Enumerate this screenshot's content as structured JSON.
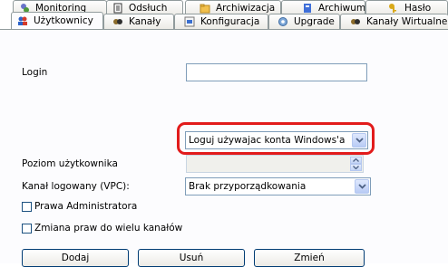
{
  "tabs_row1": [
    {
      "label": "Monitoring",
      "icon": "monitoring-icon"
    },
    {
      "label": "Odsłuch",
      "icon": "document-icon"
    },
    {
      "label": "Archiwizacja",
      "icon": "archive-folder-icon"
    },
    {
      "label": "Archiwum",
      "icon": "archive-icon"
    },
    {
      "label": "Hasło",
      "icon": "key-icon"
    }
  ],
  "tabs_row2": [
    {
      "label": "Użytkownicy",
      "icon": "users-icon",
      "active": true
    },
    {
      "label": "Kanały",
      "icon": "channels-icon"
    },
    {
      "label": "Konfiguracja",
      "icon": "configuration-icon"
    },
    {
      "label": "Upgrade",
      "icon": "upgrade-gear-icon"
    },
    {
      "label": "Kanały Wirtualne",
      "icon": "virtual-channels-icon"
    }
  ],
  "form": {
    "login_label": "Login",
    "login_value": "",
    "auth_combo_value": "Loguj używajac konta Windows'a",
    "level_label": "Poziom użytkownika",
    "level_value": "",
    "channel_label": "Kanał logowany (VPC):",
    "channel_value": "Brak przyporządkowania",
    "admin_checkbox_label": "Prawa Administratora",
    "admin_checked": false,
    "multi_channel_checkbox_label": "Zmiana praw do wielu kanałów",
    "multi_channel_checked": false
  },
  "buttons": {
    "add": "Dodaj",
    "remove": "Usuń",
    "change": "Zmień"
  },
  "colors": {
    "highlight": "#e21b1b",
    "tab_border": "#919b9c",
    "field_border": "#7f9db9"
  }
}
